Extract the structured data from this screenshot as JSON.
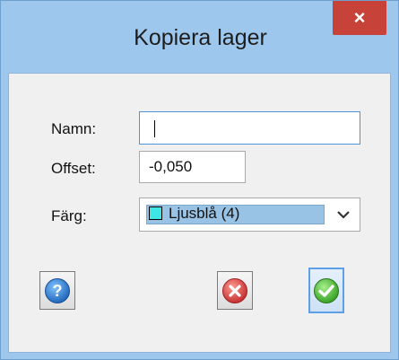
{
  "window": {
    "title": "Kopiera lager",
    "close_glyph": "×",
    "accent_color": "#9dc7ed",
    "close_color": "#c74339"
  },
  "form": {
    "name_label": "Namn:",
    "name_value": "",
    "offset_label": "Offset:",
    "offset_value": "-0,050",
    "color_label": "Färg:",
    "color_selected": "Ljusblå (4)",
    "color_swatch": "#3fe6e6"
  },
  "buttons": {
    "help_icon": "help-icon",
    "cancel_icon": "cancel-icon",
    "ok_icon": "checkmark-icon"
  }
}
